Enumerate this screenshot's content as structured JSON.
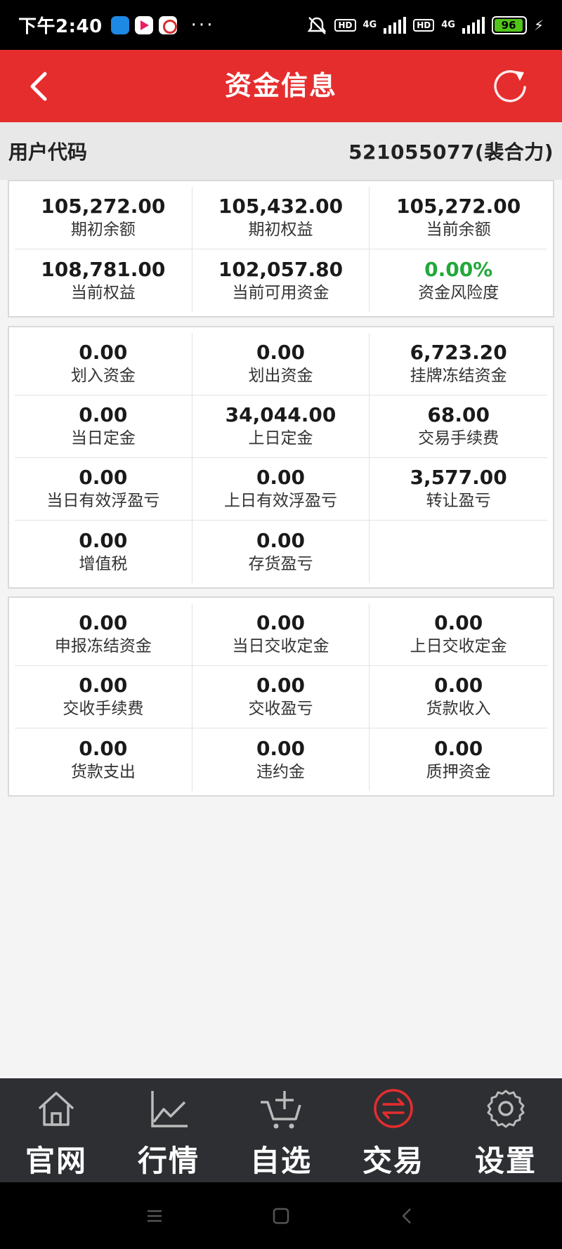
{
  "status_bar": {
    "time": "下午2:40",
    "more": "···",
    "network_1": "4G",
    "network_2": "4G",
    "hd_1": "HD",
    "hd_2": "HD",
    "battery": "96"
  },
  "header": {
    "title": "资金信息",
    "back_icon": "chevron-left-icon",
    "refresh_icon": "refresh-icon"
  },
  "user": {
    "label": "用户代码",
    "value": "521055077(裴合力)"
  },
  "panel1": [
    {
      "value": "105,272.00",
      "label": "期初余额"
    },
    {
      "value": "105,432.00",
      "label": "期初权益"
    },
    {
      "value": "105,272.00",
      "label": "当前余额"
    },
    {
      "value": "108,781.00",
      "label": "当前权益"
    },
    {
      "value": "102,057.80",
      "label": "当前可用资金"
    },
    {
      "value": "0.00%",
      "label": "资金风险度"
    }
  ],
  "panel2": [
    {
      "value": "0.00",
      "label": "划入资金"
    },
    {
      "value": "0.00",
      "label": "划出资金"
    },
    {
      "value": "6,723.20",
      "label": "挂牌冻结资金"
    },
    {
      "value": "0.00",
      "label": "当日定金"
    },
    {
      "value": "34,044.00",
      "label": "上日定金"
    },
    {
      "value": "68.00",
      "label": "交易手续费"
    },
    {
      "value": "0.00",
      "label": "当日有效浮盈亏"
    },
    {
      "value": "0.00",
      "label": "上日有效浮盈亏"
    },
    {
      "value": "3,577.00",
      "label": "转让盈亏"
    },
    {
      "value": "0.00",
      "label": "增值税"
    },
    {
      "value": "0.00",
      "label": "存货盈亏"
    },
    {
      "value": "",
      "label": ""
    }
  ],
  "panel3": [
    {
      "value": "0.00",
      "label": "申报冻结资金"
    },
    {
      "value": "0.00",
      "label": "当日交收定金"
    },
    {
      "value": "0.00",
      "label": "上日交收定金"
    },
    {
      "value": "0.00",
      "label": "交收手续费"
    },
    {
      "value": "0.00",
      "label": "交收盈亏"
    },
    {
      "value": "0.00",
      "label": "货款收入"
    },
    {
      "value": "0.00",
      "label": "货款支出"
    },
    {
      "value": "0.00",
      "label": "违约金"
    },
    {
      "value": "0.00",
      "label": "质押资金"
    }
  ],
  "nav": [
    {
      "label": "官网",
      "icon": "home-icon"
    },
    {
      "label": "行情",
      "icon": "chart-line-icon"
    },
    {
      "label": "自选",
      "icon": "cart-add-icon"
    },
    {
      "label": "交易",
      "icon": "exchange-icon"
    },
    {
      "label": "设置",
      "icon": "gear-icon"
    }
  ],
  "colors": {
    "header": "#e52d2e",
    "risk_green": "#22a83a",
    "nav_bg": "#2e2f33",
    "active_nav": "#e52d2e"
  }
}
